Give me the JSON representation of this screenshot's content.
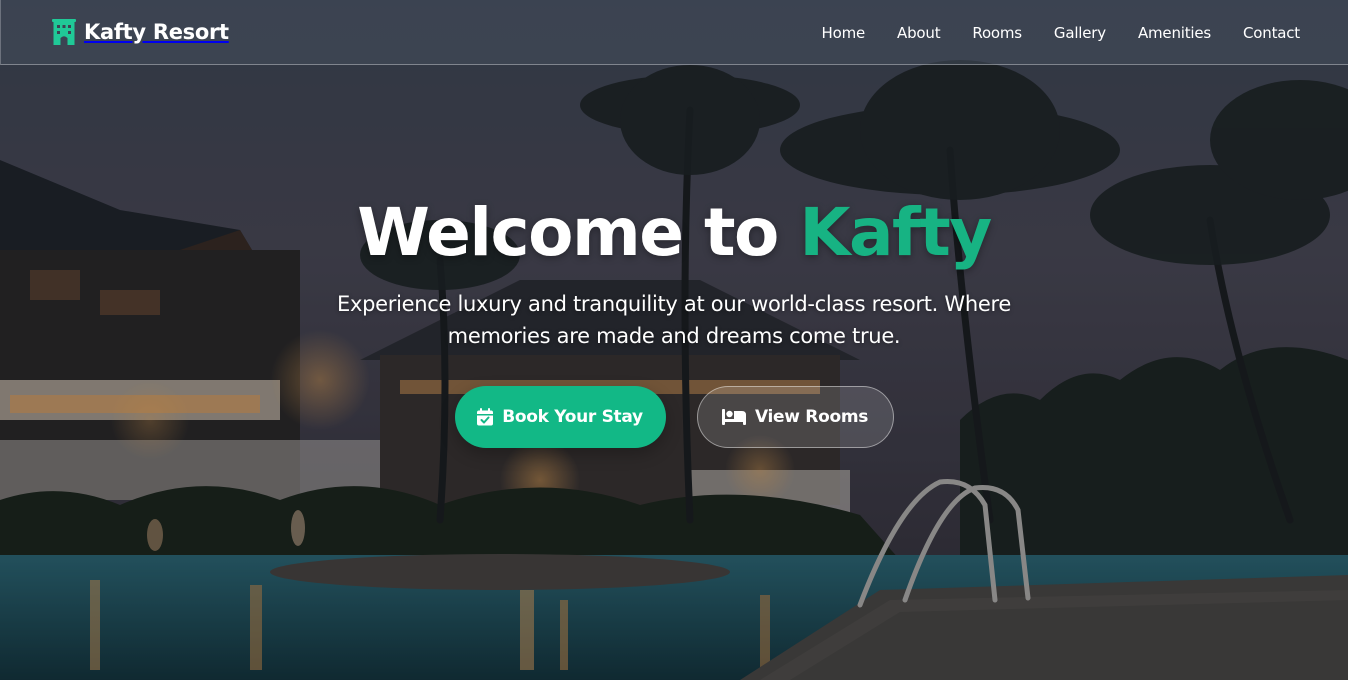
{
  "brand": {
    "name": "Kafty Resort",
    "icon": "hotel-icon",
    "accent_color": "#17b383"
  },
  "nav": {
    "items": [
      {
        "label": "Home"
      },
      {
        "label": "About"
      },
      {
        "label": "Rooms"
      },
      {
        "label": "Gallery"
      },
      {
        "label": "Amenities"
      },
      {
        "label": "Contact"
      }
    ]
  },
  "hero": {
    "title_prefix": "Welcome to ",
    "title_highlight": "Kafty",
    "subtitle": "Experience luxury and tranquility at our world-class resort. Where memories are made and dreams come true.",
    "background": "night resort pool with palm trees",
    "primary_button": {
      "label": "Book Your Stay",
      "icon": "calendar-check-icon",
      "color": "#12b886"
    },
    "secondary_button": {
      "label": "View Rooms",
      "icon": "bed-icon"
    }
  }
}
